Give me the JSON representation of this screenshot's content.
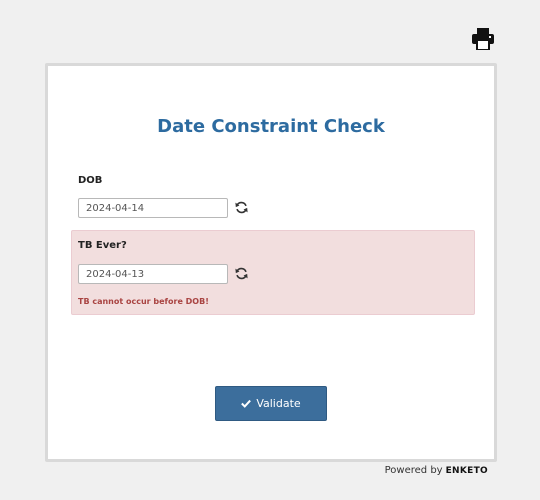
{
  "header": {
    "print_icon": "printer-icon"
  },
  "form": {
    "title": "Date Constraint Check"
  },
  "questions": [
    {
      "label": "DOB",
      "value": "2024-04-14",
      "reset_icon": "refresh-icon",
      "invalid": false
    },
    {
      "label": "TB Ever?",
      "value": "2024-04-13",
      "reset_icon": "refresh-icon",
      "invalid": true,
      "error": "TB cannot occur before DOB!"
    }
  ],
  "actions": {
    "validate_label": "Validate",
    "validate_icon": "checkmark-icon"
  },
  "footer": {
    "powered_by": "Powered by",
    "brand": "ENKETO"
  },
  "colors": {
    "title": "#2d6ba0",
    "button": "#3c6e9c",
    "error_bg": "#f2dede",
    "error_text": "#a94442"
  }
}
